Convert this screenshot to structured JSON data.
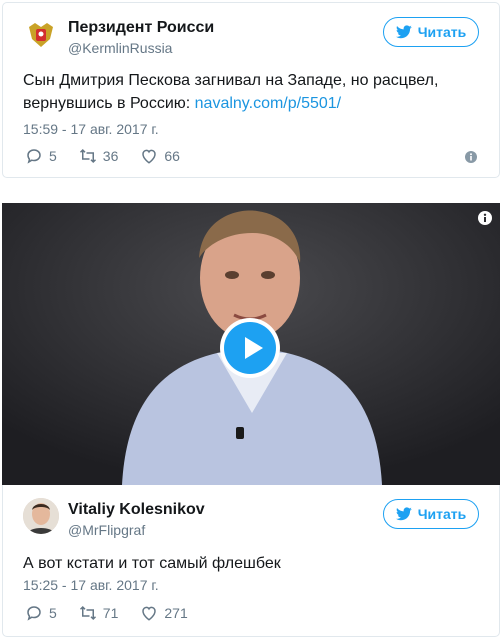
{
  "tweet1": {
    "display_name": "Перзидент Роисси",
    "handle": "@KermlinRussia",
    "follow_label": "Читать",
    "text": "Сын Дмитрия Пескова загнивал на Западе, но расцвел, вернувшись в Россию: ",
    "link_text": "navalny.com/p/5501/",
    "timestamp": "15:59 - 17 авг. 2017 г.",
    "replies": "5",
    "retweets": "36",
    "likes": "66"
  },
  "tweet2": {
    "display_name": "Vitaliy Kolesnikov",
    "handle": "@MrFlipgraf",
    "follow_label": "Читать",
    "text": "А вот кстати и тот самый флешбек",
    "timestamp": "15:25 - 17 авг. 2017 г.",
    "replies": "5",
    "retweets": "71",
    "likes": "271"
  },
  "colors": {
    "accent": "#1da1f2",
    "link": "#1b95e0",
    "muted": "#657786",
    "border": "#e1e8ed"
  },
  "icons": [
    "twitter-bird-icon",
    "reply-icon",
    "retweet-icon",
    "heart-icon",
    "info-icon",
    "play-icon"
  ]
}
